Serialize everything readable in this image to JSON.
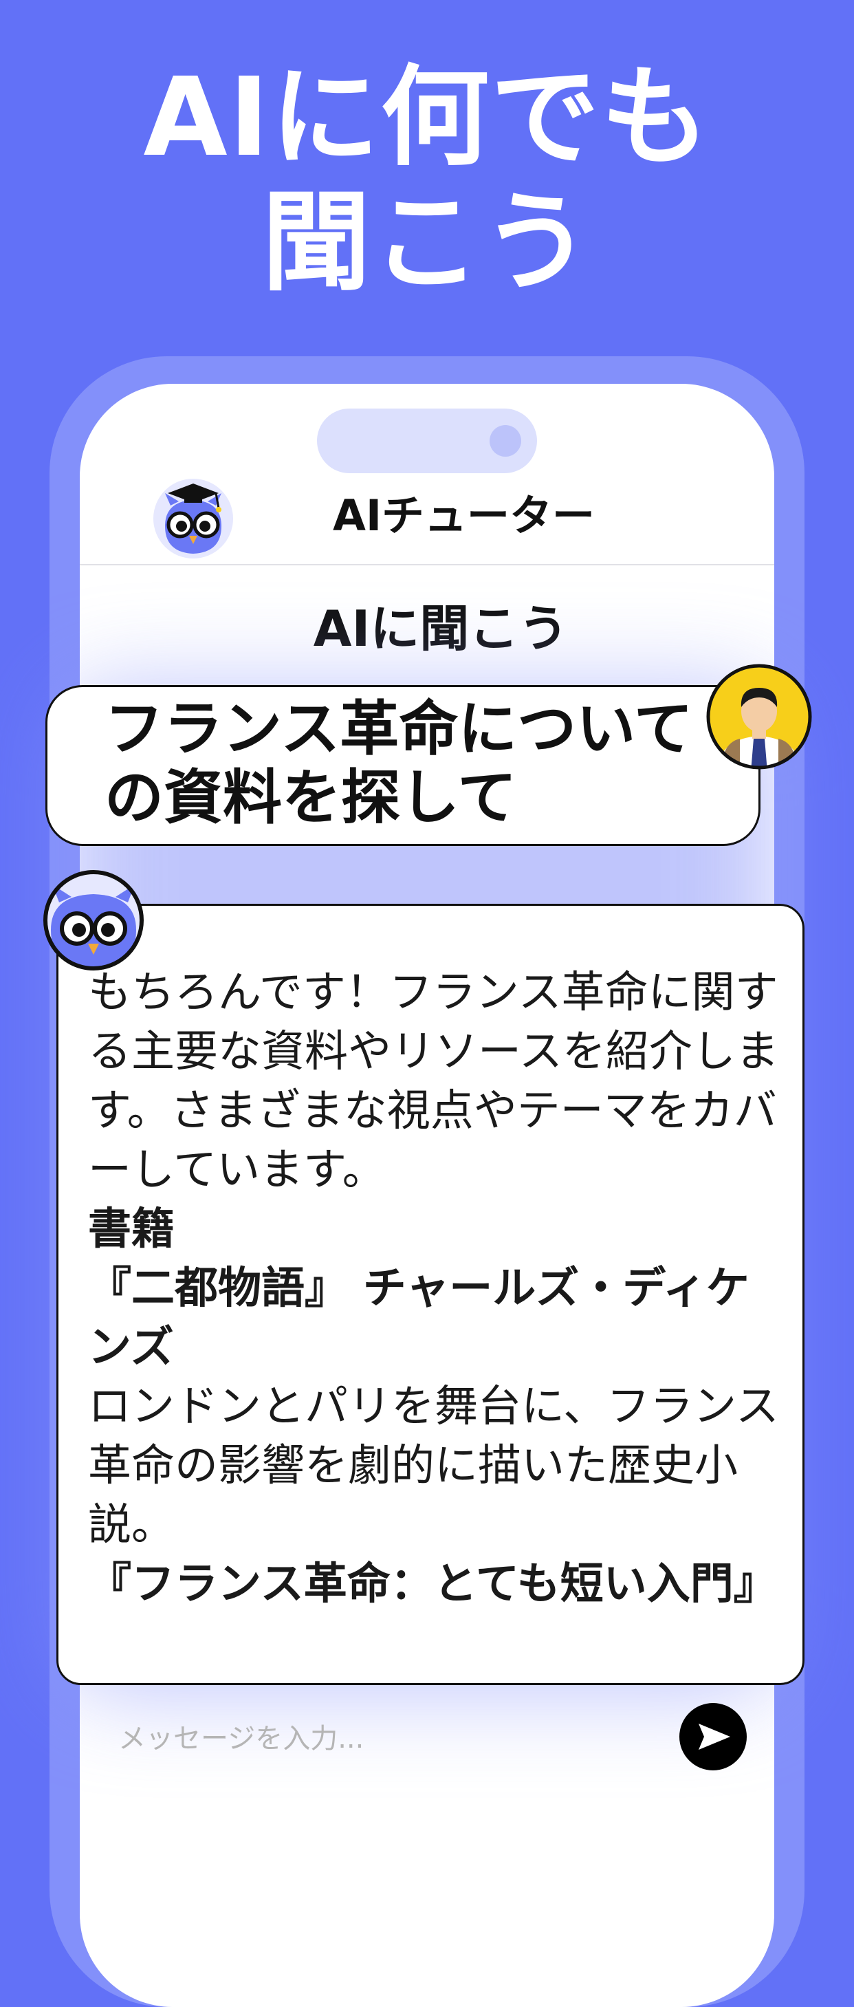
{
  "headline": {
    "line1": "AIに何でも",
    "line2": "聞こう"
  },
  "app": {
    "title": "AIチューター"
  },
  "chat": {
    "title": "AIに聞こう",
    "user_message": "フランス革命についての資料を探して",
    "bot_reply": {
      "intro": "もちろんです！フランス革命に関する主要な資料やリソースを紹介します。さまざまな視点やテーマをカバーしています。",
      "section_heading": "書籍",
      "book1_title": "『二都物語』 チャールズ・ディケンズ",
      "book1_desc": "ロンドンとパリを舞台に、フランス革命の影響を劇的に描いた歴史小説。",
      "book2_title": "『フランス革命：とても短い入門』"
    }
  },
  "input": {
    "placeholder": "メッセージを入力..."
  },
  "colors": {
    "background": "#6271F7",
    "phone_frame": "#8390FA",
    "owl_body": "#6A78F5",
    "user_avatar_bg": "#F7CF1A",
    "send_button": "#000000"
  },
  "icons": {
    "app_logo": "owl-mascot-icon",
    "user_avatar": "student-avatar-icon",
    "bot_avatar": "owl-mascot-icon",
    "send": "send-arrow-icon"
  }
}
